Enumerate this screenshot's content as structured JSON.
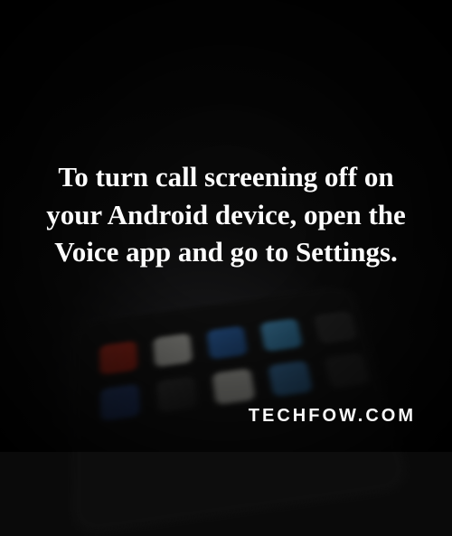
{
  "quote": "To turn call screening off on your Android device, open the Voice app and go to Settings.",
  "watermark": "TECHFOW.COM"
}
